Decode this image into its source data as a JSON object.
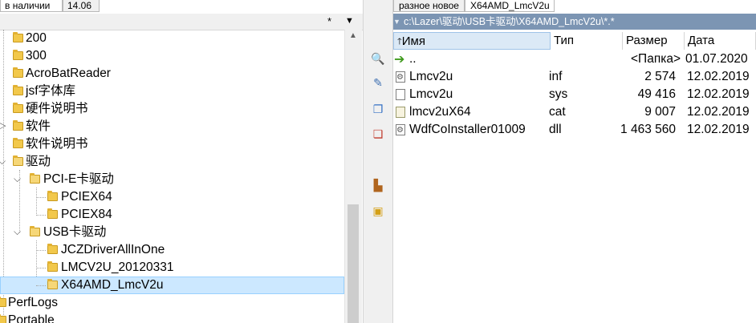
{
  "left_tabs": [
    {
      "label": "в наличии",
      "active": true
    },
    {
      "label": "14.06",
      "active": false
    }
  ],
  "tree_header": {
    "mask": "*",
    "dropdown": "▼"
  },
  "tree": [
    {
      "label": "200"
    },
    {
      "label": "300"
    },
    {
      "label": "AcroBatReader"
    },
    {
      "label": "jsf字体库"
    },
    {
      "label": "硬件说明书"
    },
    {
      "label": "软件"
    },
    {
      "label": "软件说明书"
    },
    {
      "label": "驱动"
    },
    {
      "label": "PCI-E卡驱动"
    },
    {
      "label": "PCIEX64"
    },
    {
      "label": "PCIEX84"
    },
    {
      "label": "USB卡驱动"
    },
    {
      "label": "JCZDriverAllInOne"
    },
    {
      "label": "LMCV2U_20120331"
    },
    {
      "label": "X64AMD_LmcV2u"
    },
    {
      "label": "PerfLogs"
    },
    {
      "label": "Portable"
    }
  ],
  "right_tabs": [
    {
      "label": "разное новое",
      "active": false
    },
    {
      "label": "X64AMD_LmcV2u",
      "active": true
    }
  ],
  "path": "c:\\Lazer\\驱动\\USB卡驱动\\X64AMD_LmcV2u\\*.*",
  "columns": {
    "name": "Имя",
    "type": "Тип",
    "size": "Размер",
    "date": "Дата"
  },
  "files": [
    {
      "name": "..",
      "type": "",
      "size": "<Папка>",
      "date": "01.07.2020",
      "icon": "up-arrow-icon"
    },
    {
      "name": "Lmcv2u",
      "type": "inf",
      "size": "2 574",
      "date": "12.02.2019",
      "icon": "setup-file-icon"
    },
    {
      "name": "Lmcv2u",
      "type": "sys",
      "size": "49 416",
      "date": "12.02.2019",
      "icon": "file-icon"
    },
    {
      "name": "lmcv2uX64",
      "type": "cat",
      "size": "9 007",
      "date": "12.02.2019",
      "icon": "catalog-file-icon"
    },
    {
      "name": "WdfCoInstaller01009",
      "type": "dll",
      "size": "1 463 560",
      "date": "12.02.2019",
      "icon": "dll-file-icon"
    }
  ],
  "colors": {
    "path_bar": "#7c95b3",
    "selection": "#cce8ff",
    "folder": "#f2c84b"
  }
}
